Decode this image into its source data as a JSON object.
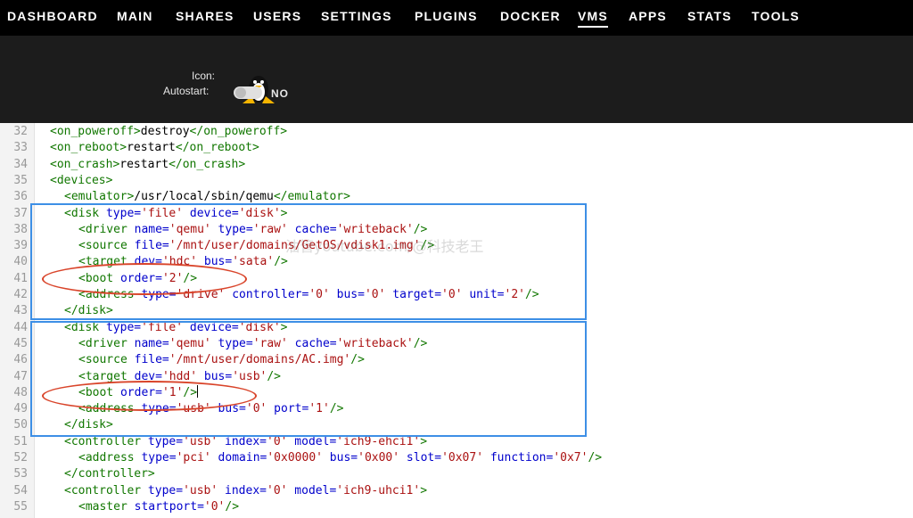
{
  "nav": [
    "DASHBOARD",
    "MAIN",
    "SHARES",
    "USERS",
    "SETTINGS",
    "PLUGINS",
    "DOCKER",
    "VMS",
    "APPS",
    "STATS",
    "TOOLS"
  ],
  "nav_active": "VMS",
  "panel": {
    "icon_label": "Icon:",
    "autostart_label": "Autostart:",
    "autostart_value": "NO"
  },
  "watermark": "油管youtube.com/@科技老王",
  "code_lines": [
    {
      "n": "32",
      "indent": 0,
      "parts": [
        [
          "tag",
          "<on_poweroff>"
        ],
        [
          "txt",
          "destroy"
        ],
        [
          "tag",
          "</on_poweroff>"
        ]
      ]
    },
    {
      "n": "33",
      "indent": 0,
      "parts": [
        [
          "tag",
          "<on_reboot>"
        ],
        [
          "txt",
          "restart"
        ],
        [
          "tag",
          "</on_reboot>"
        ]
      ]
    },
    {
      "n": "34",
      "indent": 0,
      "parts": [
        [
          "tag",
          "<on_crash>"
        ],
        [
          "txt",
          "restart"
        ],
        [
          "tag",
          "</on_crash>"
        ]
      ]
    },
    {
      "n": "35",
      "indent": 0,
      "parts": [
        [
          "tag",
          "<devices>"
        ]
      ]
    },
    {
      "n": "36",
      "indent": 1,
      "parts": [
        [
          "tag",
          "<emulator>"
        ],
        [
          "txt",
          "/usr/local/sbin/qemu"
        ],
        [
          "tag",
          "</emulator>"
        ]
      ]
    },
    {
      "n": "37",
      "indent": 1,
      "parts": [
        [
          "tag",
          "<disk "
        ],
        [
          "attr",
          "type="
        ],
        [
          "str",
          "'file'"
        ],
        [
          "attr",
          " device="
        ],
        [
          "str",
          "'disk'"
        ],
        [
          "tag",
          ">"
        ]
      ]
    },
    {
      "n": "38",
      "indent": 2,
      "parts": [
        [
          "tag",
          "<driver "
        ],
        [
          "attr",
          "name="
        ],
        [
          "str",
          "'qemu'"
        ],
        [
          "attr",
          " type="
        ],
        [
          "str",
          "'raw'"
        ],
        [
          "attr",
          " cache="
        ],
        [
          "str",
          "'writeback'"
        ],
        [
          "tag",
          "/>"
        ]
      ]
    },
    {
      "n": "39",
      "indent": 2,
      "parts": [
        [
          "tag",
          "<source "
        ],
        [
          "attr",
          "file="
        ],
        [
          "str",
          "'/mnt/user/domains/GetOS/vdisk1.img'"
        ],
        [
          "tag",
          "/>"
        ]
      ]
    },
    {
      "n": "40",
      "indent": 2,
      "parts": [
        [
          "tag",
          "<target "
        ],
        [
          "attr",
          "dev="
        ],
        [
          "str",
          "'hdc'"
        ],
        [
          "attr",
          " bus="
        ],
        [
          "str",
          "'sata'"
        ],
        [
          "tag",
          "/>"
        ]
      ]
    },
    {
      "n": "41",
      "indent": 2,
      "parts": [
        [
          "tag",
          "<boot "
        ],
        [
          "attr",
          "order="
        ],
        [
          "str",
          "'2'"
        ],
        [
          "tag",
          "/>"
        ]
      ]
    },
    {
      "n": "42",
      "indent": 2,
      "parts": [
        [
          "tag",
          "<address "
        ],
        [
          "attr",
          "type="
        ],
        [
          "str",
          "'drive'"
        ],
        [
          "attr",
          " controller="
        ],
        [
          "str",
          "'0'"
        ],
        [
          "attr",
          " bus="
        ],
        [
          "str",
          "'0'"
        ],
        [
          "attr",
          " target="
        ],
        [
          "str",
          "'0'"
        ],
        [
          "attr",
          " unit="
        ],
        [
          "str",
          "'2'"
        ],
        [
          "tag",
          "/>"
        ]
      ]
    },
    {
      "n": "43",
      "indent": 1,
      "parts": [
        [
          "tag",
          "</disk>"
        ]
      ]
    },
    {
      "n": "44",
      "indent": 1,
      "parts": [
        [
          "tag",
          "<disk "
        ],
        [
          "attr",
          "type="
        ],
        [
          "str",
          "'file'"
        ],
        [
          "attr",
          " device="
        ],
        [
          "str",
          "'disk'"
        ],
        [
          "tag",
          ">"
        ]
      ]
    },
    {
      "n": "45",
      "indent": 2,
      "parts": [
        [
          "tag",
          "<driver "
        ],
        [
          "attr",
          "name="
        ],
        [
          "str",
          "'qemu'"
        ],
        [
          "attr",
          " type="
        ],
        [
          "str",
          "'raw'"
        ],
        [
          "attr",
          " cache="
        ],
        [
          "str",
          "'writeback'"
        ],
        [
          "tag",
          "/>"
        ]
      ]
    },
    {
      "n": "46",
      "indent": 2,
      "parts": [
        [
          "tag",
          "<source "
        ],
        [
          "attr",
          "file="
        ],
        [
          "str",
          "'/mnt/user/domains/AC.img'"
        ],
        [
          "tag",
          "/>"
        ]
      ]
    },
    {
      "n": "47",
      "indent": 2,
      "parts": [
        [
          "tag",
          "<target "
        ],
        [
          "attr",
          "dev="
        ],
        [
          "str",
          "'hdd'"
        ],
        [
          "attr",
          " bus="
        ],
        [
          "str",
          "'usb'"
        ],
        [
          "tag",
          "/>"
        ]
      ]
    },
    {
      "n": "48",
      "indent": 2,
      "parts": [
        [
          "tag",
          "<boot "
        ],
        [
          "attr",
          "order="
        ],
        [
          "str",
          "'1'"
        ],
        [
          "tag",
          "/>"
        ]
      ],
      "cursor": true
    },
    {
      "n": "49",
      "indent": 2,
      "parts": [
        [
          "tag",
          "<address "
        ],
        [
          "attr",
          "type="
        ],
        [
          "str",
          "'usb'"
        ],
        [
          "attr",
          " bus="
        ],
        [
          "str",
          "'0'"
        ],
        [
          "attr",
          " port="
        ],
        [
          "str",
          "'1'"
        ],
        [
          "tag",
          "/>"
        ]
      ]
    },
    {
      "n": "50",
      "indent": 1,
      "parts": [
        [
          "tag",
          "</disk>"
        ]
      ]
    },
    {
      "n": "51",
      "indent": 1,
      "parts": [
        [
          "tag",
          "<controller "
        ],
        [
          "attr",
          "type="
        ],
        [
          "str",
          "'usb'"
        ],
        [
          "attr",
          " index="
        ],
        [
          "str",
          "'0'"
        ],
        [
          "attr",
          " model="
        ],
        [
          "str",
          "'ich9-ehci1'"
        ],
        [
          "tag",
          ">"
        ]
      ]
    },
    {
      "n": "52",
      "indent": 2,
      "parts": [
        [
          "tag",
          "<address "
        ],
        [
          "attr",
          "type="
        ],
        [
          "str",
          "'pci'"
        ],
        [
          "attr",
          " domain="
        ],
        [
          "str",
          "'0x0000'"
        ],
        [
          "attr",
          " bus="
        ],
        [
          "str",
          "'0x00'"
        ],
        [
          "attr",
          " slot="
        ],
        [
          "str",
          "'0x07'"
        ],
        [
          "attr",
          " function="
        ],
        [
          "str",
          "'0x7'"
        ],
        [
          "tag",
          "/>"
        ]
      ]
    },
    {
      "n": "53",
      "indent": 1,
      "parts": [
        [
          "tag",
          "</controller>"
        ]
      ]
    },
    {
      "n": "54",
      "indent": 1,
      "parts": [
        [
          "tag",
          "<controller "
        ],
        [
          "attr",
          "type="
        ],
        [
          "str",
          "'usb'"
        ],
        [
          "attr",
          " index="
        ],
        [
          "str",
          "'0'"
        ],
        [
          "attr",
          " model="
        ],
        [
          "str",
          "'ich9-uhci1'"
        ],
        [
          "tag",
          ">"
        ]
      ]
    },
    {
      "n": "55",
      "indent": 2,
      "parts": [
        [
          "tag",
          "<master "
        ],
        [
          "attr",
          "startport="
        ],
        [
          "str",
          "'0'"
        ],
        [
          "tag",
          "/>"
        ]
      ]
    }
  ]
}
